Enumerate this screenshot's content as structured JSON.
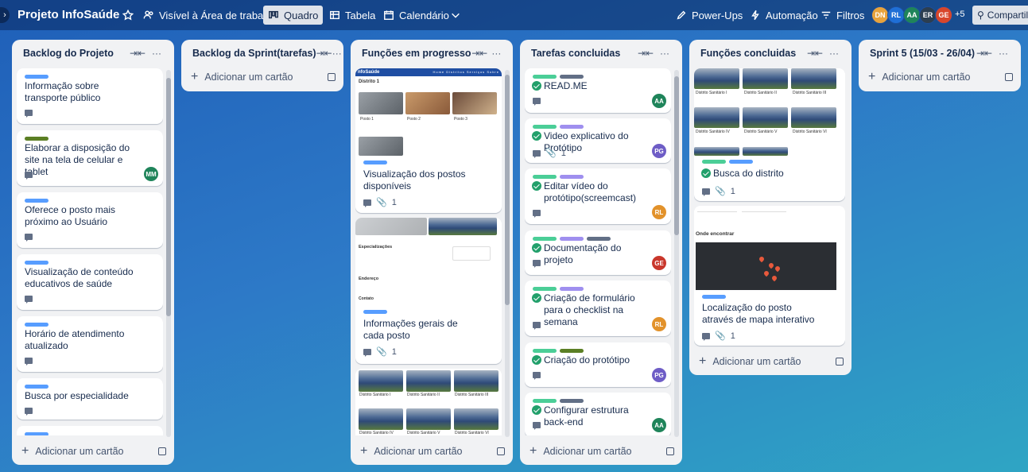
{
  "board": {
    "title": "Projeto InfoSaúde",
    "visibility": "Visível à Área de trabalho",
    "views": [
      "Quadro",
      "Tabela",
      "Calendário"
    ],
    "power_ups": "Power-Ups",
    "automation": "Automação",
    "filters": "Filtros",
    "members": [
      {
        "initials": "DN",
        "color": "#e8a33c"
      },
      {
        "initials": "RL",
        "color": "#1f6fd6"
      },
      {
        "initials": "AA",
        "color": "#1f845a"
      },
      {
        "initials": "ER",
        "color": "#2c3e50"
      },
      {
        "initials": "GE",
        "color": "#d8462b"
      }
    ],
    "more_members": "+5",
    "share": "Compartilhar"
  },
  "colors": {
    "green": "#4bce97",
    "olive": "#5b7f24",
    "blue": "#579dff",
    "purple": "#9f8fef",
    "grey": "#626f86",
    "avatar_AA": "#1f845a",
    "avatar_MM": "#1f845a",
    "avatar_PG": "#6e5dc6",
    "avatar_RL": "#e2922b",
    "avatar_GE": "#c9372c"
  },
  "add_card_label": "Adicionar um cartão",
  "lists": [
    {
      "title": "Backlog do Projeto",
      "cards": [
        {
          "title": "Informação sobre transporte público"
        },
        {
          "title": "Elaborar a disposição do site na tela de celular e tablet",
          "member": "MM"
        },
        {
          "title": "Oferece o posto mais próximo ao Usuário"
        },
        {
          "title": "Visualização de conteúdo educativos de saúde"
        },
        {
          "title": "Horário de atendimento atualizado"
        },
        {
          "title": "Busca por especialidade"
        }
      ]
    },
    {
      "title": "Backlog da Sprint(tarefas)",
      "cards": []
    },
    {
      "title": "Funções em progresso",
      "cover1": {
        "brand": "nfoSaúde",
        "nav": [
          "Home",
          "Distritos",
          "Serviços",
          "Sobre"
        ],
        "heading": "Distrito 1",
        "postos": [
          "Posto 1",
          "Posto 2",
          "Posto 3"
        ]
      },
      "cover2": {
        "spec": "Especializações",
        "end": "Endereço",
        "contato": "Contato"
      },
      "cover3": {
        "captions": [
          "Distrito Sanitário I",
          "Distrito Sanitário II",
          "Distrito Sanitário III",
          "Distrito Sanitário IV",
          "Distrito Sanitário V",
          "Distrito Sanitário VI"
        ]
      },
      "cards": [
        {
          "title": "Visualização dos postos disponíveis",
          "attachments": "1"
        },
        {
          "title": "Informações gerais de cada posto",
          "attachments": "1"
        }
      ]
    },
    {
      "title": "Tarefas concluidas",
      "cards": [
        {
          "title": "READ.ME",
          "member": "AA"
        },
        {
          "title": "Video explicativo do Protótipo",
          "attachments": "1",
          "member": "PG"
        },
        {
          "title": "Editar vídeo do protótipo(screemcast)",
          "member": "RL"
        },
        {
          "title": "Documentação do projeto",
          "member": "GE"
        },
        {
          "title": "Criação de formulário para o checklist na semana",
          "member": "RL"
        },
        {
          "title": "Criação do protótipo",
          "member": "PG"
        },
        {
          "title": "Configurar estrutura back-end",
          "member": "AA"
        }
      ]
    },
    {
      "title": "Funções concluidas",
      "cover1": {
        "captions": [
          "Distrito Sanitário I",
          "Distrito Sanitário II",
          "Distrito Sanitário III",
          "Distrito Sanitário IV",
          "Distrito Sanitário V",
          "Distrito Sanitário VI"
        ]
      },
      "cover2": {
        "heading": "Onde encontrar"
      },
      "cards": [
        {
          "title": "Busca do distrito",
          "attachments": "1"
        },
        {
          "title": "Localização do posto através de mapa interativo",
          "attachments": "1"
        }
      ]
    },
    {
      "title": "Sprint 5 (15/03 - 26/04)",
      "cards": []
    }
  ]
}
